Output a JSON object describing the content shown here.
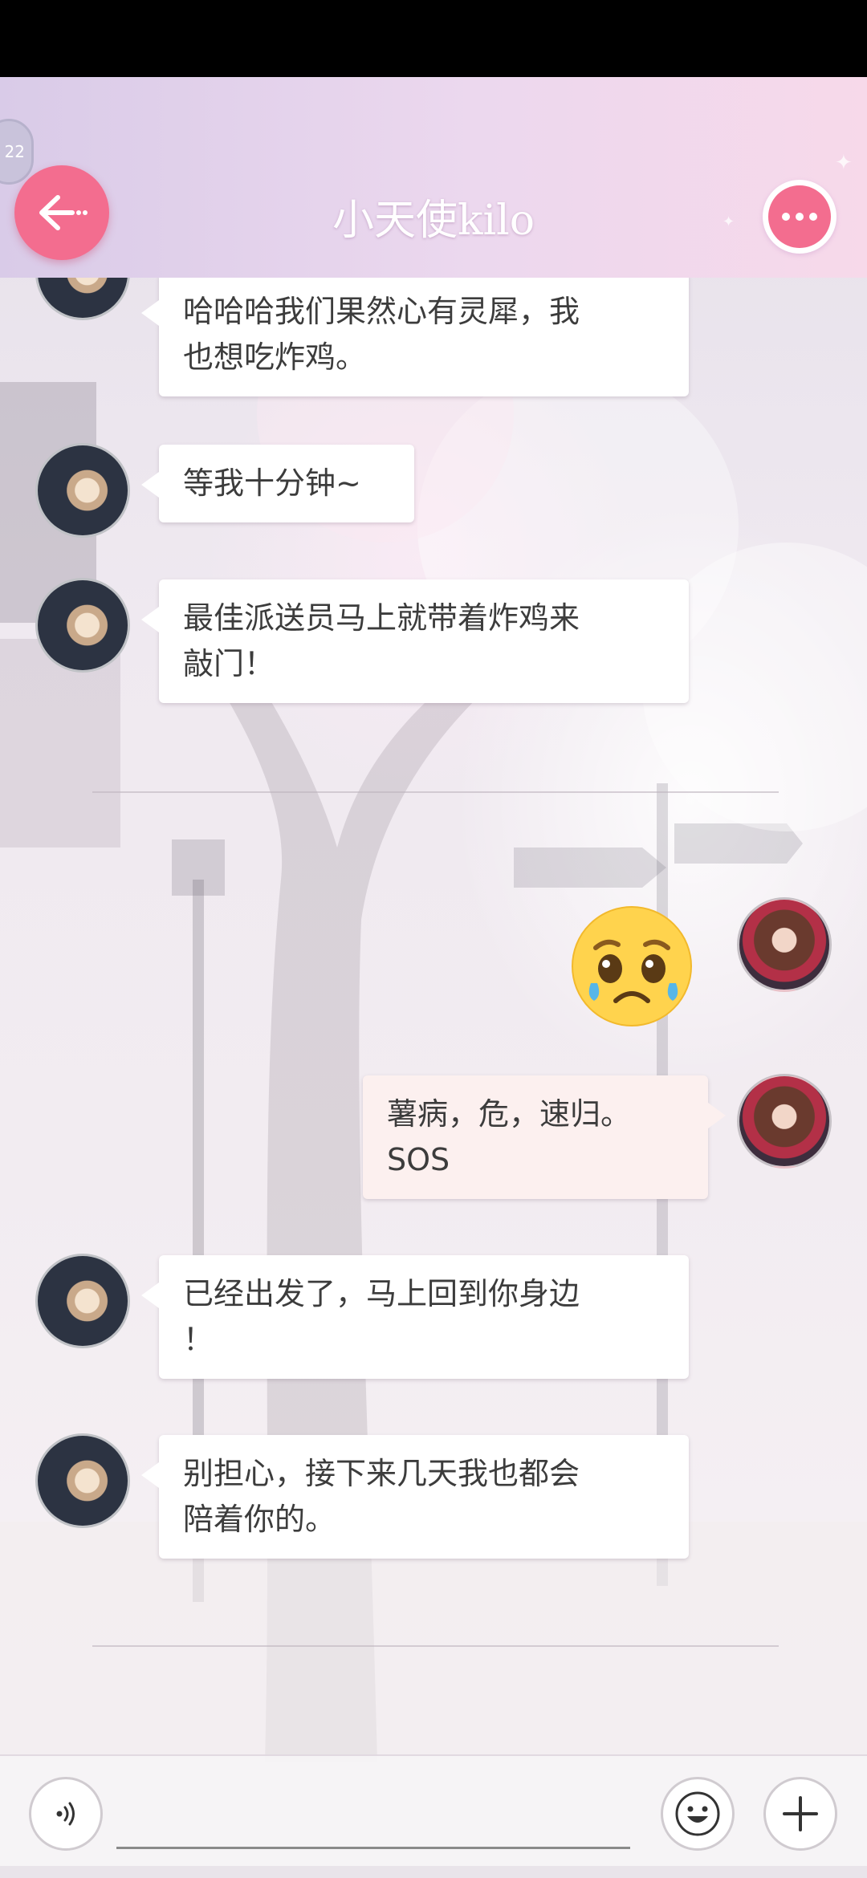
{
  "header": {
    "title": "小天使kilo",
    "clock_badge": "22",
    "accent_color": "#f36d8f"
  },
  "messages": [
    {
      "from": "contact",
      "lines": [
        "哈哈哈我们果然心有灵犀，我",
        "也想吃炸鸡。"
      ]
    },
    {
      "from": "contact",
      "lines": [
        "等我十分钟~"
      ]
    },
    {
      "from": "contact",
      "lines": [
        "最佳派送员马上就带着炸鸡来",
        "敲门！"
      ]
    },
    {
      "from": "me",
      "sticker": "pleading-face-emoji"
    },
    {
      "from": "me",
      "lines": [
        "薯病，危，速归。",
        "SOS"
      ]
    },
    {
      "from": "contact",
      "lines": [
        "已经出发了，马上回到你身边",
        "！"
      ]
    },
    {
      "from": "contact",
      "lines": [
        "别担心，接下来几天我也都会",
        "陪着你的。"
      ]
    }
  ],
  "icons": {
    "back": "arrow-left-icon",
    "more": "more-dots-icon",
    "voice": "voice-icon",
    "emoji": "emoji-icon",
    "add": "plus-icon"
  },
  "input": {
    "value": "",
    "placeholder": ""
  }
}
